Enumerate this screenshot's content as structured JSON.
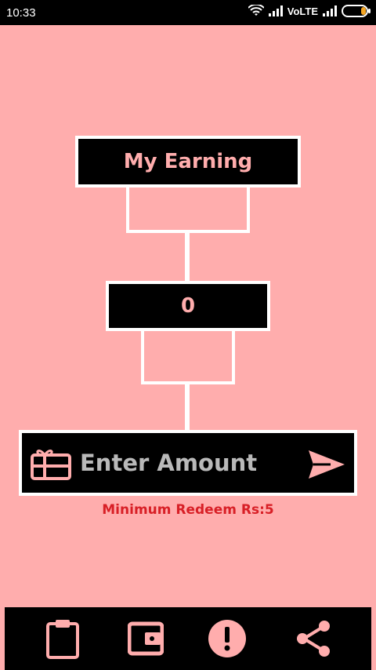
{
  "status_bar": {
    "time": "10:33",
    "network": "VoLTE"
  },
  "earning": {
    "title": "My Earning",
    "amount": "0"
  },
  "redeem": {
    "placeholder": "Enter Amount",
    "minimum_text": "Minimum Redeem Rs:5"
  },
  "nav": {
    "items": [
      {
        "icon": "clipboard-icon"
      },
      {
        "icon": "wallet-icon"
      },
      {
        "icon": "alert-icon"
      },
      {
        "icon": "share-icon"
      }
    ]
  },
  "colors": {
    "background": "#ffadad",
    "accent_text": "#ffadad",
    "warning": "#d81f26",
    "bars": "#000000"
  }
}
